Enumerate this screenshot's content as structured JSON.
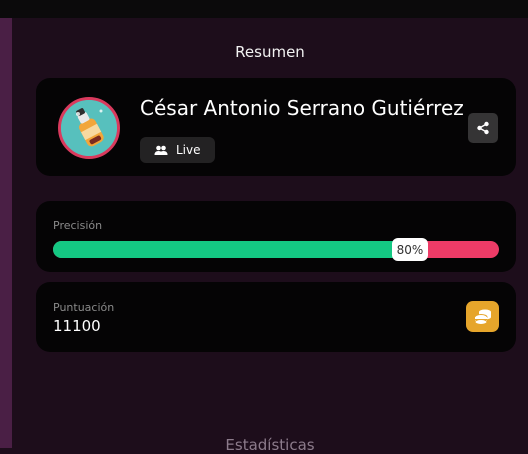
{
  "summary": {
    "title": "Resumen",
    "player_name": "César Antonio Serrano Gutiérrez",
    "status_badge": "Live",
    "share_icon": "share-icon",
    "avatar_icon": "bottle-avatar"
  },
  "precision": {
    "label": "Precisión",
    "value_text": "80%",
    "fraction": 0.8,
    "fill_color": "#14c883",
    "remaining_color": "#ee3b67"
  },
  "score": {
    "label": "Puntuación",
    "value": "11100",
    "icon": "coins-icon",
    "icon_bg": "#e6a52b"
  },
  "next_section": {
    "title": "Estadísticas"
  }
}
